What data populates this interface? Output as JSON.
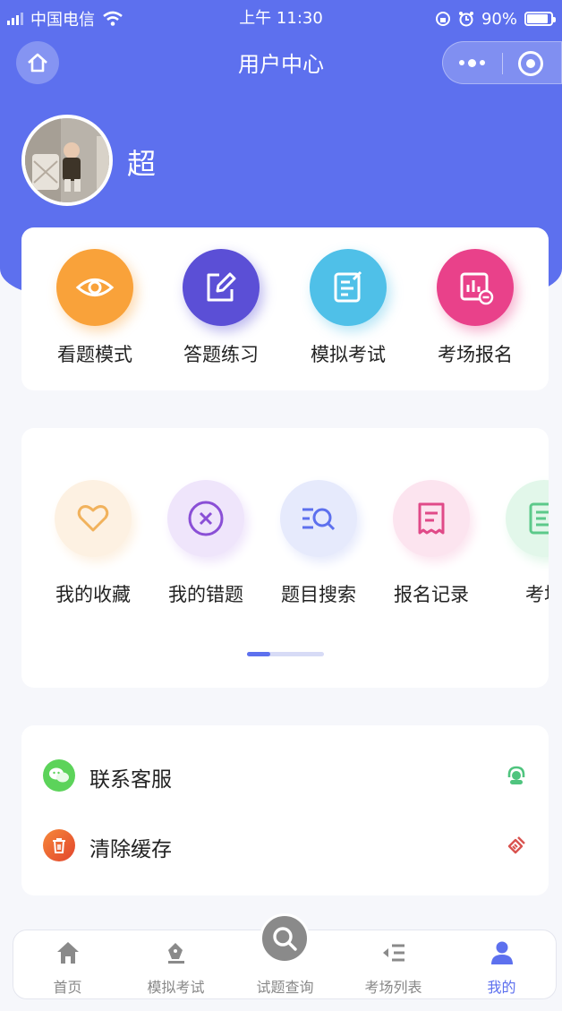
{
  "status_bar": {
    "carrier": "中国电信",
    "time": "上午 11:30",
    "battery_text": "90%",
    "battery_level": 0.9
  },
  "nav": {
    "title": "用户中心",
    "icons": [
      "home-icon",
      "more-dots-icon",
      "target-icon"
    ]
  },
  "user": {
    "name": "超"
  },
  "main_actions": [
    {
      "label": "看题模式",
      "icon": "eye-icon",
      "color": "#f9a23a"
    },
    {
      "label": "答题练习",
      "icon": "edit-icon",
      "color": "#5b4fd6"
    },
    {
      "label": "模拟考试",
      "icon": "exam-note-icon",
      "color": "#4fc0e8"
    },
    {
      "label": "考场报名",
      "icon": "chart-board-icon",
      "color": "#e9418a"
    }
  ],
  "tools": [
    {
      "label": "我的收藏",
      "icon": "heart-icon",
      "color": "#f1b25c",
      "bg": "#fdf1e2"
    },
    {
      "label": "我的错题",
      "icon": "close-circle-icon",
      "color": "#8a4fd6",
      "bg": "#efe5fb"
    },
    {
      "label": "题目搜索",
      "icon": "list-search-icon",
      "color": "#5d70ee",
      "bg": "#e6eafc"
    },
    {
      "label": "报名记录",
      "icon": "receipt-icon",
      "color": "#e04a88",
      "bg": "#fce4ef"
    },
    {
      "label": "考场",
      "icon": "document-icon",
      "color": "#5cc98a",
      "bg": "#e2f7ea"
    }
  ],
  "tools_scroll_progress": 0.3,
  "menu": [
    {
      "label": "联系客服",
      "icon": "wechat-icon",
      "right_icon": "headset-icon"
    },
    {
      "label": "清除缓存",
      "icon": "trash-icon",
      "right_icon": "broom-icon"
    }
  ],
  "tabbar": [
    {
      "label": "首页",
      "icon": "home-tab-icon",
      "active": false
    },
    {
      "label": "模拟考试",
      "icon": "pen-tab-icon",
      "active": false
    },
    {
      "label": "试题查询",
      "icon": "search-tab-icon",
      "active": false
    },
    {
      "label": "考场列表",
      "icon": "list-tab-icon",
      "active": false
    },
    {
      "label": "我的",
      "icon": "user-tab-icon",
      "active": true
    }
  ],
  "colors": {
    "brand": "#5d70ee",
    "active_tab": "#5d70ee",
    "inactive_tab": "#888888"
  }
}
